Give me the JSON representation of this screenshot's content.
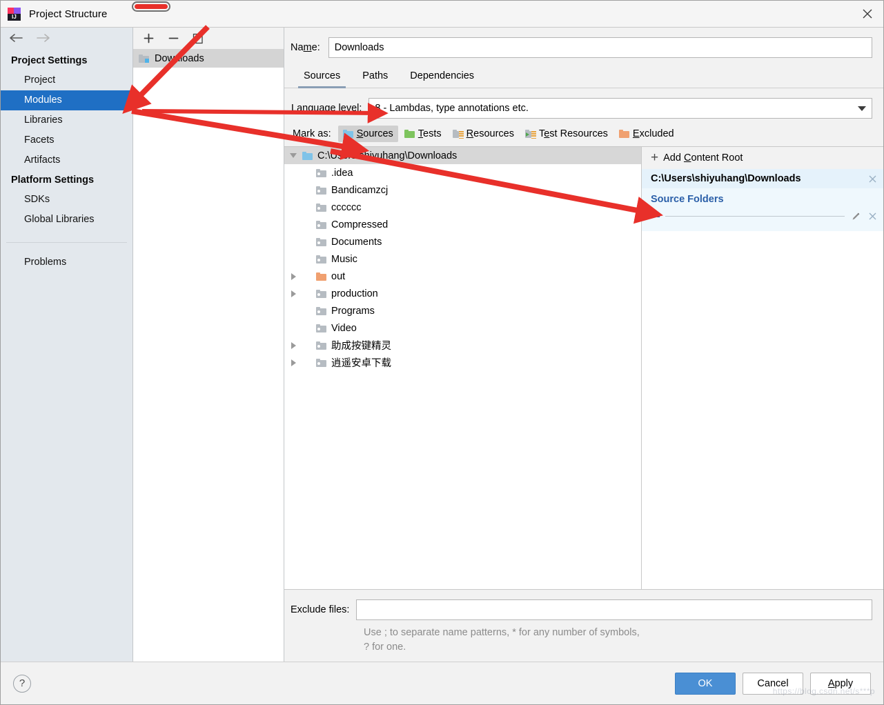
{
  "window": {
    "title": "Project Structure",
    "app_icon": "intellij-idea-icon",
    "close_icon": "close-icon"
  },
  "nav": {
    "back_icon": "arrow-left-icon",
    "forward_icon": "arrow-right-icon"
  },
  "sidebar": {
    "groups": [
      {
        "title": "Project Settings",
        "items": [
          {
            "label": "Project",
            "selected": false
          },
          {
            "label": "Modules",
            "selected": true
          },
          {
            "label": "Libraries",
            "selected": false
          },
          {
            "label": "Facets",
            "selected": false
          },
          {
            "label": "Artifacts",
            "selected": false
          }
        ]
      },
      {
        "title": "Platform Settings",
        "items": [
          {
            "label": "SDKs",
            "selected": false
          },
          {
            "label": "Global Libraries",
            "selected": false
          }
        ]
      }
    ],
    "problems_label": "Problems",
    "selected_color": "#1f6fc4"
  },
  "modules_panel": {
    "toolbar": {
      "add_icon": "plus-icon",
      "remove_icon": "minus-icon",
      "copy_icon": "copy-icon"
    },
    "items": [
      {
        "label": "Downloads",
        "selected": true
      }
    ]
  },
  "editor": {
    "name_label": "Name:",
    "name_value": "Downloads",
    "tabs": [
      {
        "label": "Sources",
        "active": true
      },
      {
        "label": "Paths",
        "active": false
      },
      {
        "label": "Dependencies",
        "active": false
      }
    ],
    "language_level_label": "Language level:",
    "language_level_value": "8 - Lambdas, type annotations etc.",
    "mark_as_label": "Mark as:",
    "mark_as_buttons": [
      {
        "label": "Sources",
        "icon": "folder-sources-icon",
        "color": "#7fc3e8",
        "active": true
      },
      {
        "label": "Tests",
        "icon": "folder-tests-icon",
        "color": "#7ec45e",
        "active": false
      },
      {
        "label": "Resources",
        "icon": "folder-resources-icon",
        "color": "#b6bcc2",
        "active": false
      },
      {
        "label": "Test Resources",
        "icon": "folder-test-resources-icon",
        "color": "#b6bcc2",
        "active": false
      },
      {
        "label": "Excluded",
        "icon": "folder-excluded-icon",
        "color": "#f0a070",
        "active": false
      }
    ]
  },
  "tree": {
    "root": {
      "label": "C:\\Users\\shiyuhang\\Downloads",
      "expanded": true,
      "selected": true,
      "folder_color": "blue"
    },
    "children": [
      {
        "label": ".idea",
        "expandable": false,
        "folder_color": "grey"
      },
      {
        "label": "Bandicamzcj",
        "expandable": false,
        "folder_color": "grey"
      },
      {
        "label": "cccccc",
        "expandable": false,
        "folder_color": "grey"
      },
      {
        "label": "Compressed",
        "expandable": false,
        "folder_color": "grey"
      },
      {
        "label": "Documents",
        "expandable": false,
        "folder_color": "grey"
      },
      {
        "label": "Music",
        "expandable": false,
        "folder_color": "grey"
      },
      {
        "label": "out",
        "expandable": true,
        "folder_color": "orange"
      },
      {
        "label": "production",
        "expandable": true,
        "folder_color": "grey"
      },
      {
        "label": "Programs",
        "expandable": false,
        "folder_color": "grey"
      },
      {
        "label": "Video",
        "expandable": false,
        "folder_color": "grey"
      },
      {
        "label": "助成按键精灵",
        "expandable": true,
        "folder_color": "grey"
      },
      {
        "label": "逍遥安卓下载",
        "expandable": true,
        "folder_color": "grey"
      }
    ]
  },
  "content_roots": {
    "add_label": "Add Content Root",
    "add_icon": "plus-icon",
    "root_path": "C:\\Users\\shiyuhang\\Downloads",
    "remove_root_icon": "close-icon",
    "source_folders_title": "Source Folders",
    "source_folders_color": "#2b5fa8",
    "entries": [
      {
        "label": ".",
        "edit_icon": "pencil-icon",
        "remove_icon": "close-icon"
      }
    ]
  },
  "exclude": {
    "label": "Exclude files:",
    "value": "",
    "hint": "Use ; to separate name patterns, * for any number of symbols, ? for one."
  },
  "footer": {
    "help_label": "?",
    "ok_label": "OK",
    "cancel_label": "Cancel",
    "apply_label": "Apply",
    "ok_color": "#4a8fd4"
  },
  "annotations": {
    "color": "#e8302a",
    "marks": [
      {
        "name": "top-pill-highlight",
        "kind": "pill"
      },
      {
        "name": "arrow-to-modules",
        "kind": "arrow"
      },
      {
        "name": "arrow-to-language-level",
        "kind": "arrow"
      },
      {
        "name": "arrow-to-mark-as-sources",
        "kind": "arrow"
      },
      {
        "name": "arrow-to-source-folders",
        "kind": "arrow"
      }
    ]
  },
  "watermark": {
    "text": "https://blog.csdn.net/s***p"
  }
}
